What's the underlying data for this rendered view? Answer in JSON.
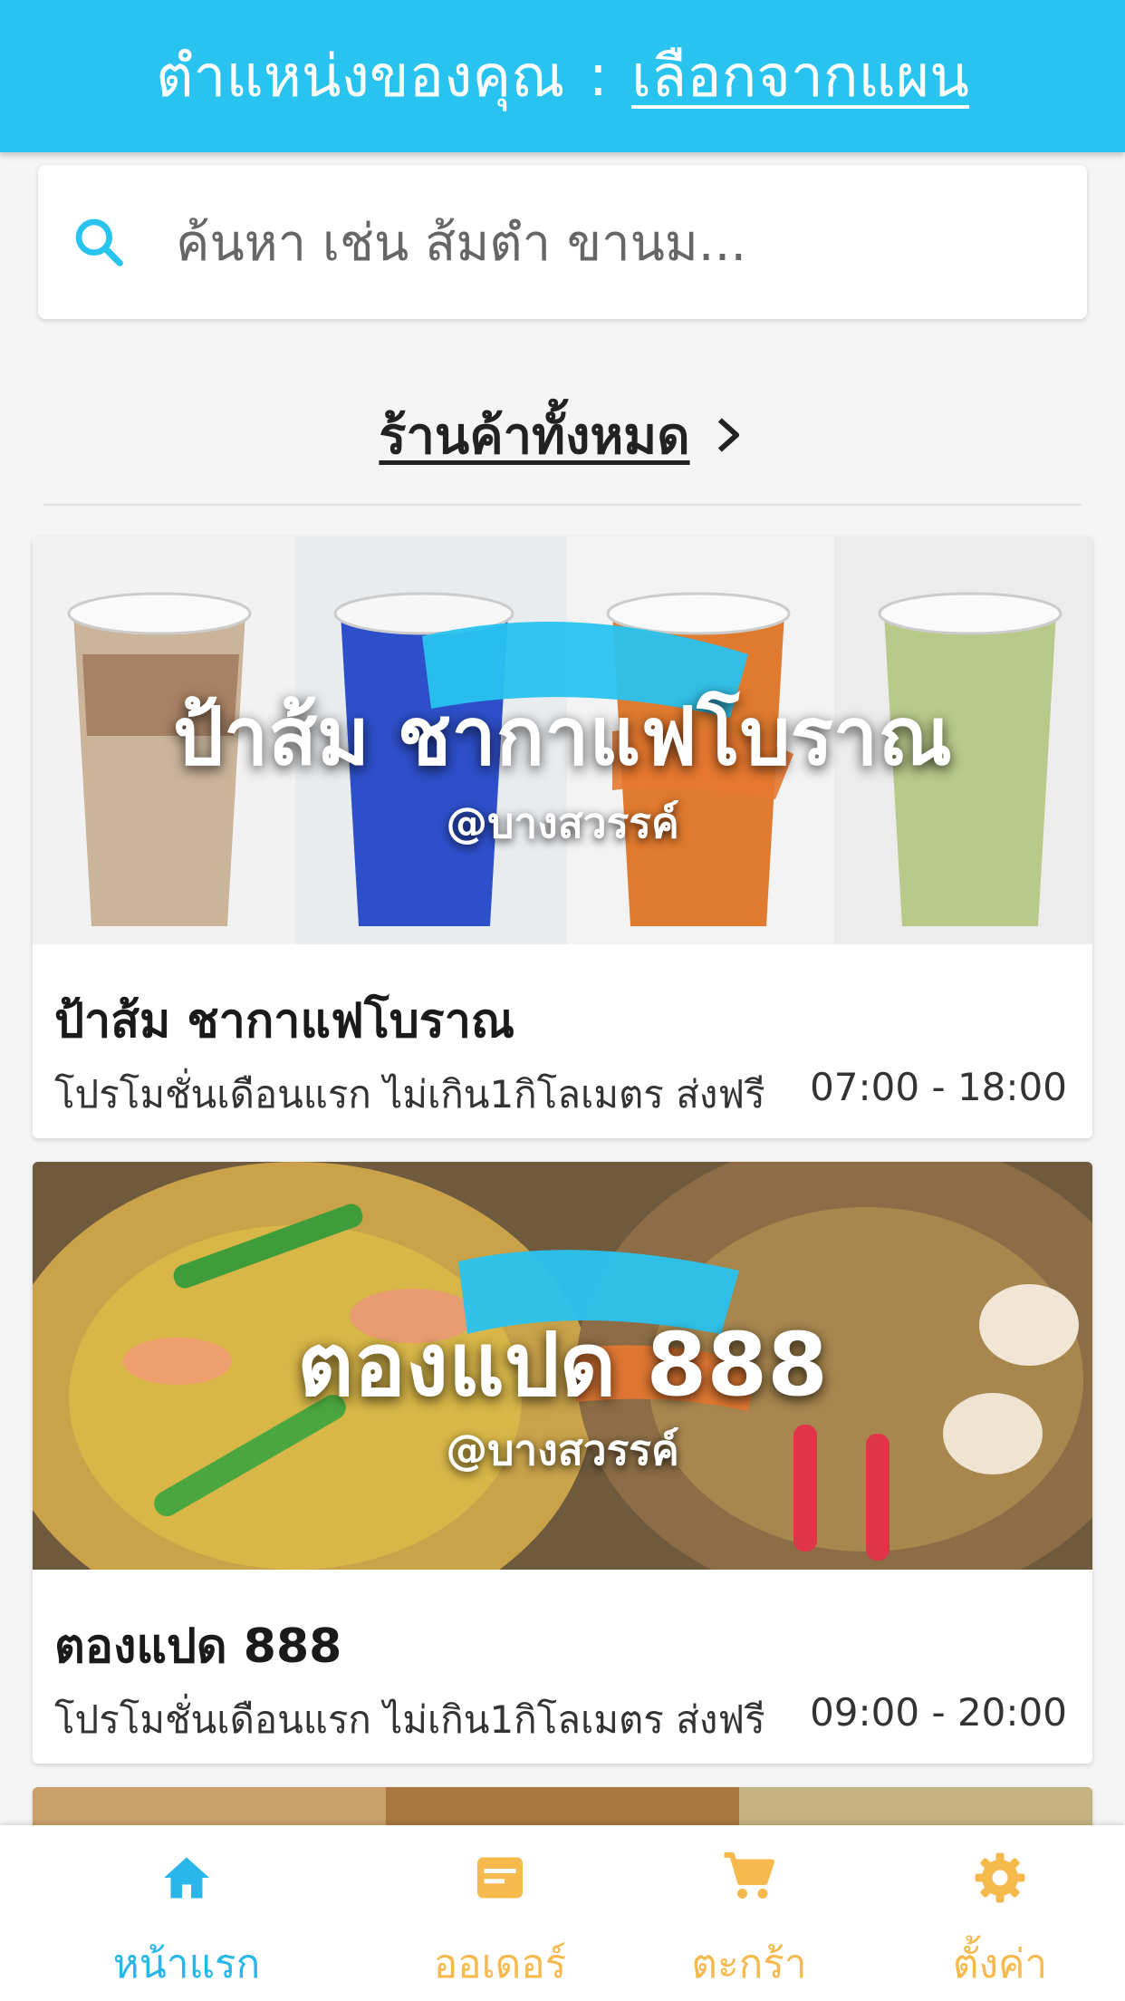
{
  "header": {
    "location_label": "ตำแหน่งของคุณ",
    "separator": ":",
    "location_link": "เลือกจากแผน"
  },
  "search": {
    "placeholder": "ค้นหา เช่น ส้มตำ ขานม..."
  },
  "all_stores": {
    "label": "ร้านค้าทั้งหมด"
  },
  "stores": [
    {
      "name": "ป้าส้ม ชากาแฟโบราณ",
      "banner_title": "ป้าส้ม ชากาแฟโบราณ",
      "banner_sub": "@บางสวรรค์",
      "promo": "โปรโมชั่นเดือนแรก ไม่เกิน1กิโลเมตร ส่งฟรี",
      "hours": "07:00 - 18:00"
    },
    {
      "name": "ตองแปด 888",
      "banner_title": "ตองแปด 888",
      "banner_sub": "@บางสวรรค์",
      "promo": "โปรโมชั่นเดือนแรก ไม่เกิน1กิโลเมตร ส่งฟรี",
      "hours": "09:00 - 20:00"
    }
  ],
  "bottom_nav": {
    "items": [
      {
        "label": "หน้าแรก",
        "icon": "home-icon",
        "active": true
      },
      {
        "label": "ออเดอร์",
        "icon": "order-icon",
        "active": false
      },
      {
        "label": "ตะกร้า",
        "icon": "cart-icon",
        "active": false
      },
      {
        "label": "ตั้งค่า",
        "icon": "gear-icon",
        "active": false
      }
    ]
  },
  "colors": {
    "accent": "#29c3ef",
    "nav_active": "#29b6e8",
    "nav_inactive": "#f5b94e"
  }
}
